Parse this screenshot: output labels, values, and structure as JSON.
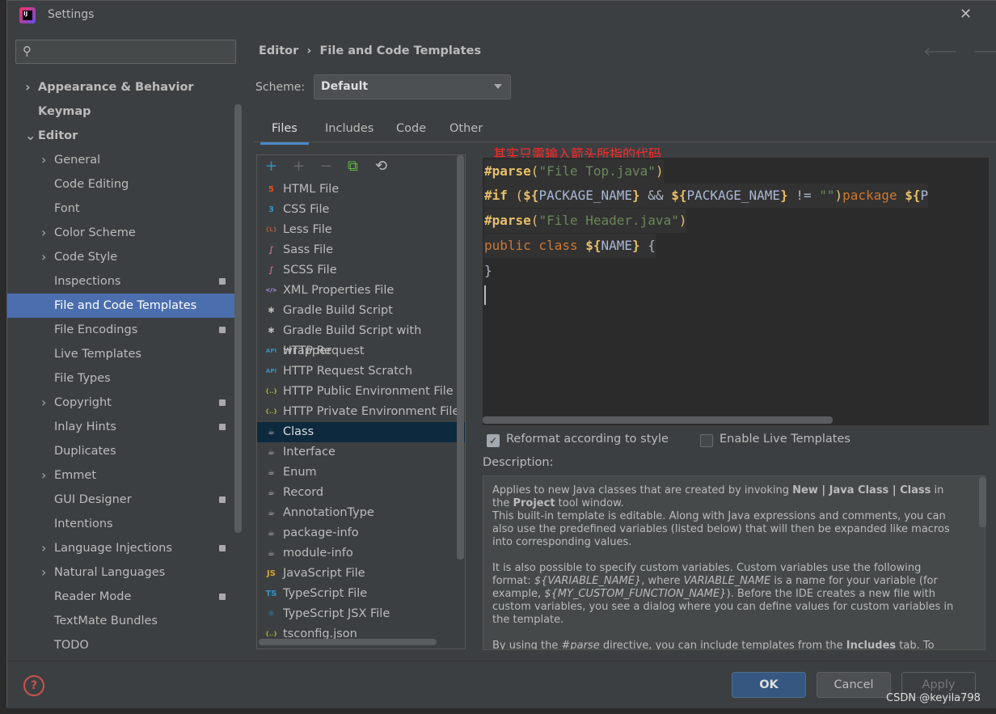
{
  "window": {
    "title": "Settings",
    "close": "✕"
  },
  "search": {
    "placeholder": "",
    "icon": "search-icon"
  },
  "sidebar": {
    "items": [
      {
        "label": "Appearance & Behavior",
        "level": 0,
        "chevron": "›",
        "bold": true
      },
      {
        "label": "Keymap",
        "level": 0,
        "bold": true
      },
      {
        "label": "Editor",
        "level": 0,
        "chevron": "⌄",
        "bold": true
      },
      {
        "label": "General",
        "level": 1,
        "chevron": "›"
      },
      {
        "label": "Code Editing",
        "level": 1
      },
      {
        "label": "Font",
        "level": 1
      },
      {
        "label": "Color Scheme",
        "level": 1,
        "chevron": "›"
      },
      {
        "label": "Code Style",
        "level": 1,
        "chevron": "›"
      },
      {
        "label": "Inspections",
        "level": 1,
        "badge": true
      },
      {
        "label": "File and Code Templates",
        "level": 1,
        "selected": true
      },
      {
        "label": "File Encodings",
        "level": 1,
        "badge": true
      },
      {
        "label": "Live Templates",
        "level": 1
      },
      {
        "label": "File Types",
        "level": 1
      },
      {
        "label": "Copyright",
        "level": 1,
        "chevron": "›",
        "badge": true
      },
      {
        "label": "Inlay Hints",
        "level": 1,
        "badge": true
      },
      {
        "label": "Duplicates",
        "level": 1
      },
      {
        "label": "Emmet",
        "level": 1,
        "chevron": "›"
      },
      {
        "label": "GUI Designer",
        "level": 1,
        "badge": true
      },
      {
        "label": "Intentions",
        "level": 1
      },
      {
        "label": "Language Injections",
        "level": 1,
        "chevron": "›",
        "badge": true
      },
      {
        "label": "Natural Languages",
        "level": 1,
        "chevron": "›"
      },
      {
        "label": "Reader Mode",
        "level": 1,
        "badge": true
      },
      {
        "label": "TextMate Bundles",
        "level": 1
      },
      {
        "label": "TODO",
        "level": 1
      }
    ]
  },
  "breadcrumb": {
    "parent": "Editor",
    "separator": "›",
    "current": "File and Code Templates"
  },
  "scheme": {
    "label": "Scheme:",
    "value": "Default"
  },
  "tabs": [
    {
      "label": "Files",
      "active": true
    },
    {
      "label": "Includes"
    },
    {
      "label": "Code"
    },
    {
      "label": "Other"
    }
  ],
  "list_toolbar": [
    {
      "icon": "add-icon",
      "glyph": "+",
      "color": "#3592c4"
    },
    {
      "icon": "add-child-icon",
      "glyph": "+",
      "color": "#666"
    },
    {
      "icon": "remove-icon",
      "glyph": "−",
      "color": "#666"
    },
    {
      "icon": "copy-icon",
      "glyph": "⧉",
      "color": "#62b543"
    },
    {
      "icon": "reset-icon",
      "glyph": "⟲",
      "color": "#bbb"
    }
  ],
  "templates": [
    {
      "label": "HTML File",
      "icon": "html5-icon",
      "glyph": "5",
      "color": "#e44d26"
    },
    {
      "label": "CSS File",
      "icon": "css3-icon",
      "glyph": "3",
      "color": "#3592c4"
    },
    {
      "label": "Less File",
      "icon": "less-icon",
      "glyph": "{L}",
      "color": "#b0573c"
    },
    {
      "label": "Sass File",
      "icon": "sass-icon",
      "glyph": "∫",
      "color": "#cf649a"
    },
    {
      "label": "SCSS File",
      "icon": "scss-icon",
      "glyph": "∫",
      "color": "#cf649a"
    },
    {
      "label": "XML Properties File",
      "icon": "xml-icon",
      "glyph": "</>",
      "color": "#b99bf8"
    },
    {
      "label": "Gradle Build Script",
      "icon": "gradle-icon",
      "glyph": "✱",
      "color": "#bbb"
    },
    {
      "label": "Gradle Build Script with wrapper",
      "icon": "gradle-icon",
      "glyph": "✱",
      "color": "#bbb"
    },
    {
      "label": "HTTP Request",
      "icon": "api-icon",
      "glyph": "API",
      "color": "#3592c4"
    },
    {
      "label": "HTTP Request Scratch",
      "icon": "api-icon",
      "glyph": "API",
      "color": "#3592c4"
    },
    {
      "label": "HTTP Public Environment File",
      "icon": "json-icon",
      "glyph": "{..}",
      "color": "#a7b03a"
    },
    {
      "label": "HTTP Private Environment File",
      "icon": "json-icon",
      "glyph": "{..}",
      "color": "#a7b03a"
    },
    {
      "label": "Class",
      "icon": "java-icon",
      "glyph": "☕",
      "color": "#bbb",
      "selected": true
    },
    {
      "label": "Interface",
      "icon": "java-icon",
      "glyph": "☕",
      "color": "#bbb"
    },
    {
      "label": "Enum",
      "icon": "java-icon",
      "glyph": "☕",
      "color": "#bbb"
    },
    {
      "label": "Record",
      "icon": "java-icon",
      "glyph": "☕",
      "color": "#bbb"
    },
    {
      "label": "AnnotationType",
      "icon": "java-icon",
      "glyph": "☕",
      "color": "#bbb"
    },
    {
      "label": "package-info",
      "icon": "java-icon",
      "glyph": "☕",
      "color": "#bbb"
    },
    {
      "label": "module-info",
      "icon": "java-icon",
      "glyph": "☕",
      "color": "#bbb"
    },
    {
      "label": "JavaScript File",
      "icon": "javascript-icon",
      "glyph": "JS",
      "color": "#d9a33a"
    },
    {
      "label": "TypeScript File",
      "icon": "typescript-icon",
      "glyph": "TS",
      "color": "#3592c4"
    },
    {
      "label": "TypeScript JSX File",
      "icon": "react-icon",
      "glyph": "⚛",
      "color": "#3592c4"
    },
    {
      "label": "tsconfig.json",
      "icon": "json-icon",
      "glyph": "{..}",
      "color": "#a7b03a"
    }
  ],
  "annotation": "其实只需输入箭头所指的代码",
  "code": {
    "l1": {
      "kw": "#parse",
      "p1": "(",
      "s": "\"File Top.java\"",
      "p2": ")"
    },
    "l2": {
      "kw": "#if",
      "sp": " (",
      "d1": "${",
      "v1": "PACKAGE_NAME",
      "c1": "}",
      "op": " && ",
      "d2": "${",
      "v2": "PACKAGE_NAME",
      "c2": "}",
      "op2": " != ",
      "s": "\"\"",
      "p": ")",
      "pkg": "package ",
      "d3": "${",
      "v3": "P"
    },
    "l3": {
      "kw": "#parse",
      "p1": "(",
      "s": "\"File Header.java\"",
      "p2": ")"
    },
    "l4": {
      "pub": "public class ",
      "d": "${",
      "v": "NAME",
      "c": "}",
      "b": " {"
    },
    "l5": "}"
  },
  "options": {
    "reformat": {
      "label": "Reformat according to style",
      "checked": true
    },
    "live": {
      "label": "Enable Live Templates",
      "checked": false
    }
  },
  "description": {
    "label": "Description:",
    "p1a": "Applies to new Java classes that are created by invoking ",
    "p1b": "New | Java Class | Class",
    "p1c": " in the ",
    "p1d": "Project",
    "p1e": " tool window.",
    "p2": "This built-in template is editable. Along with Java expressions and comments, you can also use the predefined variables (listed below) that will then be expanded like macros into corresponding values.",
    "p3a": "It is also possible to specify custom variables. Custom variables use the following format: ",
    "p3b": "${VARIABLE_NAME}",
    "p3c": ", where ",
    "p3d": "VARIABLE_NAME",
    "p3e": " is a name for your variable (for example, ",
    "p3f": "${MY_CUSTOM_FUNCTION_NAME}",
    "p3g": "). Before the IDE creates a new file with custom variables, you see a dialog where you can define values for custom variables in the template.",
    "p4a": "By using the ",
    "p4b": "#parse",
    "p4c": " directive, you can include templates from the ",
    "p4d": "Includes",
    "p4e": " tab. To include"
  },
  "footer": {
    "help": "?",
    "ok": "OK",
    "cancel": "Cancel",
    "apply": "Apply"
  },
  "watermark": "CSDN @keyila798",
  "colors": {
    "selection": "#4b6eaf",
    "accent": "#4a88c7",
    "annotation": "#ff2a2a",
    "ok_button": "#365880"
  }
}
